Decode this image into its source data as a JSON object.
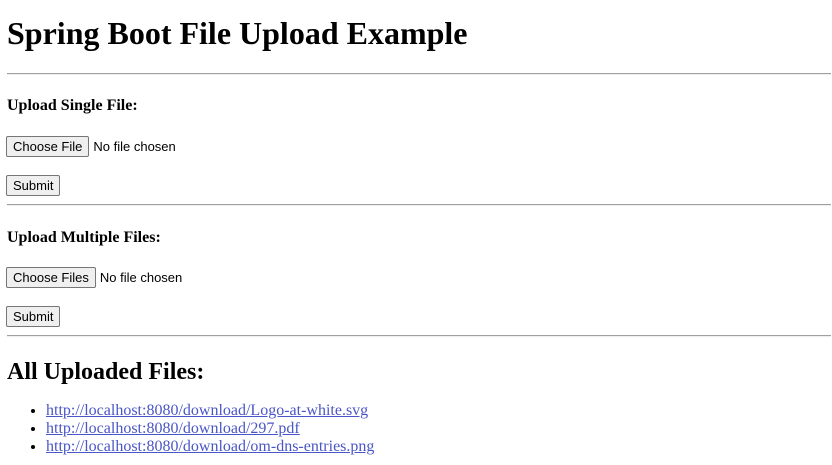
{
  "page": {
    "title": "Spring Boot File Upload Example"
  },
  "single_upload": {
    "heading": "Upload Single File:",
    "choose_label": "Choose File",
    "status": "No file chosen",
    "submit_label": "Submit"
  },
  "multiple_upload": {
    "heading": "Upload Multiple Files:",
    "choose_label": "Choose Files",
    "status": "No file chosen",
    "submit_label": "Submit"
  },
  "uploaded": {
    "heading": "All Uploaded Files:",
    "links": [
      "http://localhost:8080/download/Logo-at-white.svg",
      "http://localhost:8080/download/297.pdf",
      "http://localhost:8080/download/om-dns-entries.png"
    ]
  },
  "colors": {
    "link": "#4a55c7",
    "button_bg": "#efefef"
  }
}
